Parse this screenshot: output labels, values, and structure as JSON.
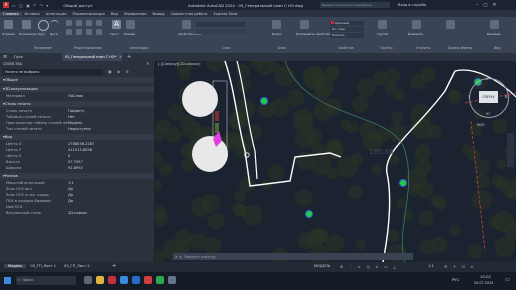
{
  "app": {
    "title": "Autodesk AutoCAD 2024 · 05_Генеральный план С НО.dwg",
    "share": "Общий доступ",
    "search_placeholder": "Введите ключевое слово/фразу",
    "signin": "Вход в службы"
  },
  "ribbon": {
    "tabs": [
      "Главная",
      "Вставка",
      "Аннотации",
      "Параметризация",
      "Вид",
      "Управление",
      "Вывод",
      "Совместная работа",
      "Express Tools"
    ],
    "active_tab": "Главная",
    "buttons": {
      "polyline": "Отрезок",
      "polyline2": "Полилиния",
      "circle": "Круг",
      "arc": "Дуга",
      "text": "Текст",
      "dimension": "Размер",
      "layer_props": "Свойства слоя",
      "block": "Блоки",
      "insert": "Вставить",
      "copy_props": "Копировать свойства",
      "measure": "Измерить",
      "group": "Группа",
      "utilities": "Утилиты",
      "clipboard": "Буфер обмена",
      "base": "Базовый"
    },
    "panels": [
      "Рисование",
      "Редактирование",
      "Аннотации",
      "Слои",
      "Блок",
      "Свойства",
      "Группы",
      "Утилиты",
      "Буфер обмена",
      "Вид"
    ],
    "properties": {
      "color": "Красный",
      "lineweight": "По слою",
      "linetype": "ПоСлою"
    }
  },
  "filetabs": {
    "start": "Пуск",
    "active": "05_Генеральный план С НО*"
  },
  "properties_panel": {
    "title": "СВОЙСТВА",
    "selector": "Ничего не выбрано",
    "sections": [
      {
        "name": "Общие",
        "rows": []
      },
      {
        "name": "3D-визуализация",
        "rows": [
          [
            "Материал",
            "ПоСлою"
          ]
        ]
      },
      {
        "name": "Стиль печати",
        "rows": [
          [
            "Стиль печати",
            "ПоЦвету"
          ],
          [
            "Таблица стилей печати",
            "Нет"
          ],
          [
            "Пространство таблиц стилей печати",
            "Модель"
          ],
          [
            "Тип стилей печати",
            "Недоступна"
          ]
        ]
      },
      {
        "name": "Вид",
        "rows": [
          [
            "Центр X",
            "2788036.2287"
          ],
          [
            "Центр Y",
            "411513.8098"
          ],
          [
            "Центр Z",
            "0"
          ],
          [
            "Высота",
            "57.7557"
          ],
          [
            "Ширина",
            "92.8992"
          ]
        ]
      },
      {
        "name": "Разное",
        "rows": [
          [
            "Масштаб аннотаций",
            "1:1"
          ],
          [
            "Знак ПСК вкл",
            "Да"
          ],
          [
            "Знак ПСК в нач. коорд.",
            "Да"
          ],
          [
            "ПСК в каждом Видовом",
            "Да"
          ],
          [
            "Имя ПСК",
            ""
          ],
          [
            "Визуальный стиль",
            "2D-каркас"
          ]
        ]
      }
    ]
  },
  "viewport": {
    "label": "[-][Сверху][2D-каркас]",
    "viewcube_face": "СВЕРХУ",
    "compass": {
      "n": "С",
      "s": "Ю",
      "w": "З",
      "e": "В"
    },
    "wcs": "МСК",
    "command_placeholder": "Введите команду",
    "map_text": "165.66"
  },
  "status": {
    "tabs": [
      "Модель",
      "05_ГП_Лист 1",
      "05_ГП_Лист 2"
    ],
    "active_tab": "Модель",
    "mode": "МОДЕЛЬ",
    "scale": "1:1"
  },
  "taskbar": {
    "search": "Поиск",
    "lang": "РУС",
    "time": "10:02",
    "date": "20.07.2024"
  },
  "colors": {
    "accent_green": "#22cc44",
    "accent_blue": "#2b63d6",
    "selection_pink": "#e040e0",
    "drawing_white": "#ffffff",
    "drawing_red": "#d04040"
  }
}
